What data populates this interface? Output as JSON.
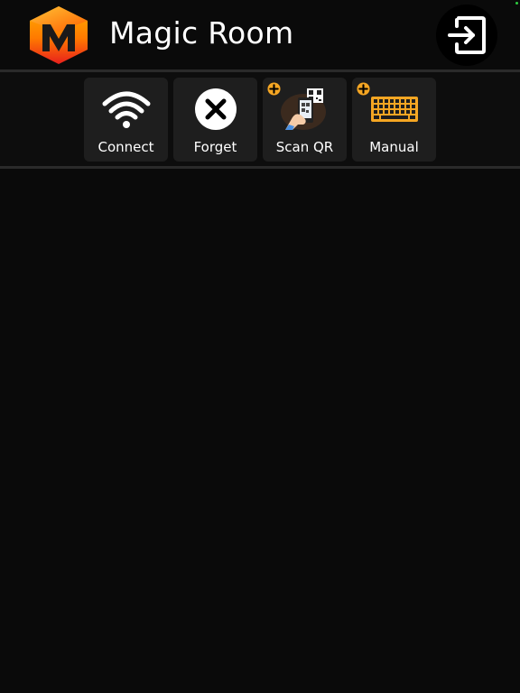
{
  "app": {
    "title": "Magic Room"
  },
  "header": {
    "logo_icon": "magic-room-logo",
    "exit_icon": "exit-arrow-icon"
  },
  "toolbar": {
    "items": [
      {
        "label": "Connect",
        "icon": "wifi-icon",
        "badge": false
      },
      {
        "label": "Forget",
        "icon": "close-circle-icon",
        "badge": false
      },
      {
        "label": "Scan QR",
        "icon": "qr-phone-icon",
        "badge": true
      },
      {
        "label": "Manual",
        "icon": "keyboard-icon",
        "badge": true
      }
    ]
  },
  "colors": {
    "background": "#0a0a0a",
    "tile": "#1e1e1e",
    "accent": "#f5a623",
    "divider": "#2a2a2a"
  }
}
